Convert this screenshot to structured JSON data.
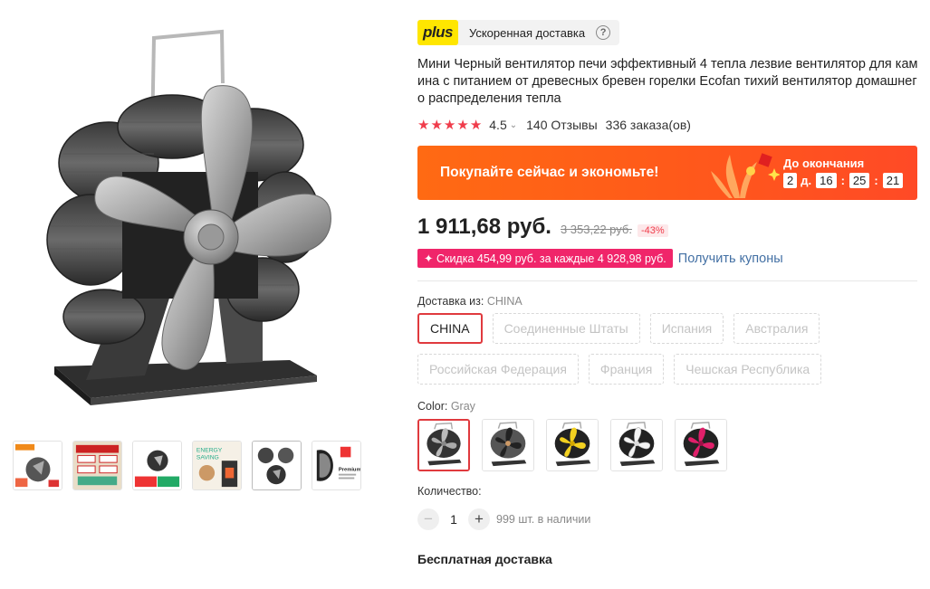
{
  "plus": {
    "logo": "plus",
    "label": "Ускоренная доставка"
  },
  "title": "Мини Черный вентилятор печи эффективный 4 тепла лезвие вентилятор для камина с питанием от древесных бревен горелки Ecofan тихий вентилятор домашнего распределения тепла",
  "rating": {
    "stars": 5,
    "value": "4.5",
    "reviews": "140 Отзывы",
    "orders": "336 заказа(ов)"
  },
  "promo": {
    "text": "Покупайте сейчас и экономьте!",
    "countdown_label": "До окончания",
    "days": "2",
    "days_unit": "д.",
    "hours": "16",
    "minutes": "25",
    "seconds": "21"
  },
  "price": {
    "current": "1 911,68 руб.",
    "old": "3 353,22 руб.",
    "discount": "-43%"
  },
  "coupon": {
    "badge": "✦ Скидка 454,99 руб. за каждые 4 928,98 руб.",
    "link": "Получить купоны"
  },
  "shipping": {
    "label": "Доставка из:",
    "selected": "CHINA",
    "options": [
      "CHINA",
      "Соединенные Штаты",
      "Испания",
      "Австралия",
      "Российская Федерация",
      "Франция",
      "Чешская Республика"
    ]
  },
  "color": {
    "label": "Color:",
    "selected": "Gray",
    "swatches": [
      "gray",
      "black",
      "yellow",
      "white",
      "pink"
    ]
  },
  "quantity": {
    "label": "Количество:",
    "value": "1",
    "stock": "999 шт. в наличии"
  },
  "free_shipping": "Бесплатная доставка",
  "gallery": {
    "thumbnail_count": 6
  },
  "colors": {
    "accent": "#f03c4b",
    "promo": "#ff6a13",
    "coupon": "#f0256a",
    "plus": "#ffe600",
    "link": "#4370a4"
  }
}
